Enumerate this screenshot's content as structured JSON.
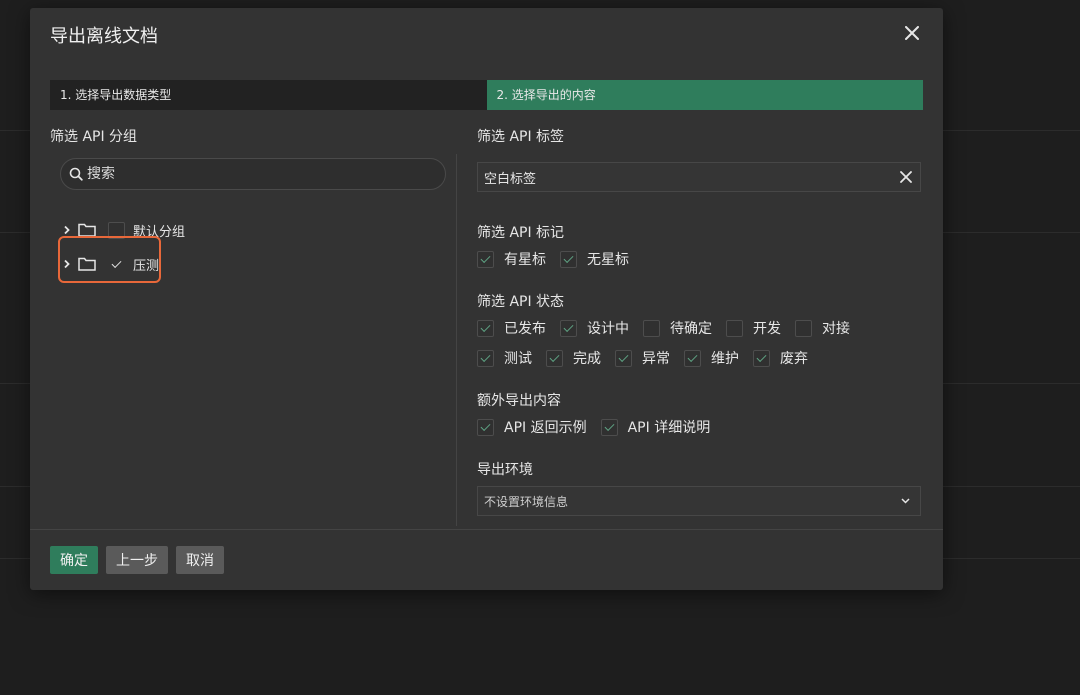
{
  "dialog": {
    "title": "导出离线文档",
    "steps": [
      "1. 选择导出数据类型",
      "2. 选择导出的内容"
    ]
  },
  "left": {
    "group_label": "筛选 API 分组",
    "search_placeholder": "搜索",
    "tree": [
      {
        "label": "默认分组",
        "checked": false
      },
      {
        "label": "压测",
        "checked": true
      }
    ]
  },
  "right": {
    "tag_label": "筛选 API 标签",
    "tag_value": "空白标签",
    "mark_label": "筛选 API 标记",
    "marks": [
      {
        "label": "有星标",
        "checked": true
      },
      {
        "label": "无星标",
        "checked": true
      }
    ],
    "status_label": "筛选 API 状态",
    "status_row1": [
      {
        "label": "已发布",
        "checked": true
      },
      {
        "label": "设计中",
        "checked": true
      },
      {
        "label": "待确定",
        "checked": false
      },
      {
        "label": "开发",
        "checked": false
      },
      {
        "label": "对接",
        "checked": false
      }
    ],
    "status_row2": [
      {
        "label": "测试",
        "checked": true
      },
      {
        "label": "完成",
        "checked": true
      },
      {
        "label": "异常",
        "checked": true
      },
      {
        "label": "维护",
        "checked": true
      },
      {
        "label": "废弃",
        "checked": true
      }
    ],
    "extra_label": "额外导出内容",
    "extras": [
      {
        "label": "API 返回示例",
        "checked": true
      },
      {
        "label": "API 详细说明",
        "checked": true
      }
    ],
    "env_label": "导出环境",
    "env_value": "不设置环境信息"
  },
  "footer": {
    "confirm": "确定",
    "prev": "上一步",
    "cancel": "取消"
  },
  "colors": {
    "accent": "#2f7d5c",
    "highlight": "#e8683a"
  }
}
